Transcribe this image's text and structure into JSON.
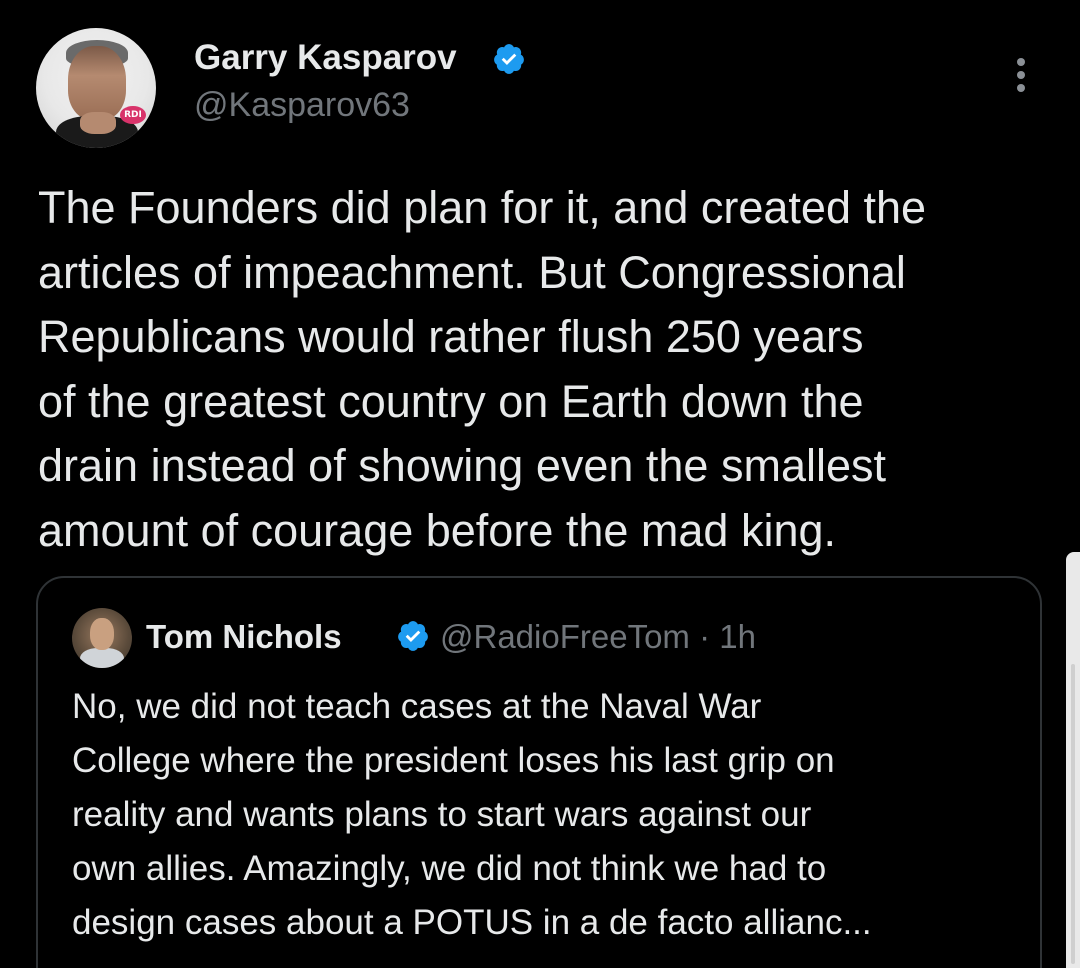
{
  "tweet": {
    "author": {
      "name": "Garry Kasparov",
      "handle": "@Kasparov63",
      "verified": true,
      "avatar_badge": "RDI"
    },
    "text_lines": [
      "The Founders did plan for it, and created the",
      "articles of impeachment. But Congressional",
      "Republicans would rather flush 250 years",
      "of the greatest country on Earth down the",
      "drain instead of showing even the smallest",
      "amount of courage before the mad king."
    ],
    "quoted": {
      "name": "Tom Nichols",
      "handle_time": "@RadioFreeTom · 1h",
      "verified": true,
      "text_lines": [
        "No, we did not teach cases at the Naval War",
        "College where the president loses his last grip on",
        "reality and wants plans to start wars against our",
        "own allies. Amazingly, we did not think we had to",
        "design cases about a POTUS in a de facto allianc..."
      ]
    }
  },
  "icons": {
    "verified": "verified-badge-icon",
    "more": "more-options-icon"
  },
  "colors": {
    "background": "#000000",
    "text_primary": "#e7e9ea",
    "text_secondary": "#71767b",
    "verified_blue": "#1d9bf0",
    "card_border": "#2f3336"
  }
}
